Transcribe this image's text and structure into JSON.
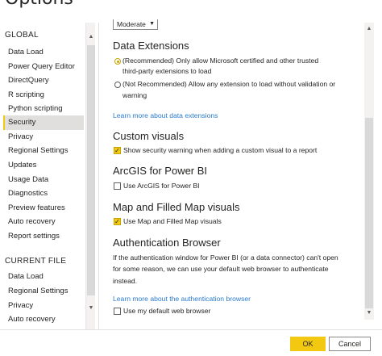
{
  "window": {
    "title": "Options"
  },
  "sidebar": {
    "global_heading": "GLOBAL",
    "global_items": [
      {
        "label": "Data Load"
      },
      {
        "label": "Power Query Editor"
      },
      {
        "label": "DirectQuery"
      },
      {
        "label": "R scripting"
      },
      {
        "label": "Python scripting"
      },
      {
        "label": "Security",
        "selected": true
      },
      {
        "label": "Privacy"
      },
      {
        "label": "Regional Settings"
      },
      {
        "label": "Updates"
      },
      {
        "label": "Usage Data"
      },
      {
        "label": "Diagnostics"
      },
      {
        "label": "Preview features"
      },
      {
        "label": "Auto recovery"
      },
      {
        "label": "Report settings"
      }
    ],
    "current_file_heading": "CURRENT FILE",
    "current_file_items": [
      {
        "label": "Data Load"
      },
      {
        "label": "Regional Settings"
      },
      {
        "label": "Privacy"
      },
      {
        "label": "Auto recovery"
      }
    ]
  },
  "content": {
    "dropdown_value": "Moderate",
    "data_extensions": {
      "heading": "Data Extensions",
      "option1_line1": "(Recommended) Only allow Microsoft certified and other trusted",
      "option1_line2": "third-party extensions to load",
      "option1_selected": true,
      "option2_line1": "(Not Recommended) Allow any extension to load without validation or",
      "option2_line2": "warning",
      "option2_selected": false,
      "link": "Learn more about data extensions"
    },
    "custom_visuals": {
      "heading": "Custom visuals",
      "checkbox_label": "Show security warning when adding a custom visual to a report",
      "checked": true
    },
    "arcgis": {
      "heading": "ArcGIS for Power BI",
      "checkbox_label": "Use ArcGIS for Power BI",
      "checked": false
    },
    "map_visuals": {
      "heading": "Map and Filled Map visuals",
      "checkbox_label": "Use Map and Filled Map visuals",
      "checked": true
    },
    "auth_browser": {
      "heading": "Authentication Browser",
      "desc_line1": "If the authentication window for Power BI (or a data connector) can't open",
      "desc_line2": "for some reason, we can use your default web browser to authenticate",
      "desc_line3": "instead.",
      "link": "Learn more about the authentication browser",
      "checkbox_label": "Use my default web browser",
      "checked": false
    }
  },
  "footer": {
    "ok_label": "OK",
    "cancel_label": "Cancel"
  },
  "colors": {
    "accent": "#f2c811",
    "link": "#2b7bd0",
    "selected_bg": "#e1dfdd"
  },
  "icons": {
    "check": "check-icon",
    "scroll_up": "chevron-up-icon",
    "scroll_down": "chevron-down-icon",
    "dropdown": "chevron-down-icon"
  }
}
